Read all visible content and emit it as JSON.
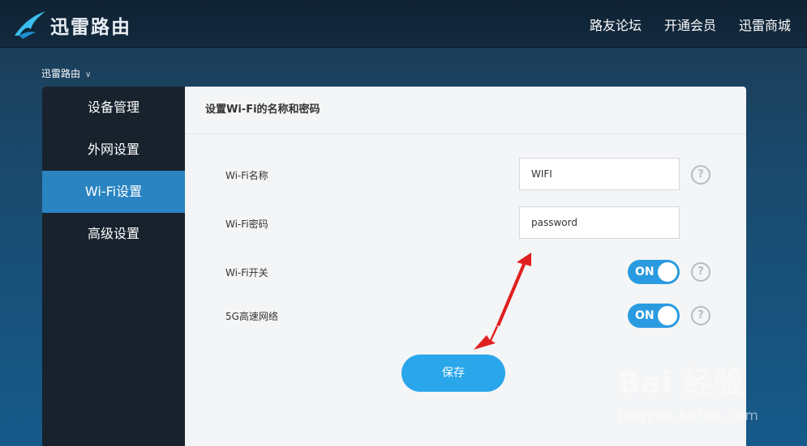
{
  "header": {
    "brand": "迅雷路由",
    "nav": [
      "路友论坛",
      "开通会员",
      "迅雷商城"
    ],
    "logo_icon": "xunlei-bird-icon"
  },
  "router_selector": {
    "label": "迅雷路由"
  },
  "sidebar": {
    "items": [
      {
        "label": "设备管理",
        "active": false
      },
      {
        "label": "外网设置",
        "active": false
      },
      {
        "label": "Wi-Fi设置",
        "active": true
      },
      {
        "label": "高级设置",
        "active": false
      }
    ]
  },
  "content": {
    "title": "设置Wi-Fi的名称和密码",
    "fields": {
      "wifi_name": {
        "label": "Wi-Fi名称",
        "value": "WIFI"
      },
      "wifi_password": {
        "label": "Wi-Fi密码",
        "value": "password"
      }
    },
    "toggles": {
      "wifi_switch": {
        "label": "Wi-Fi开关",
        "state": "ON"
      },
      "fiveg": {
        "label": "5G高速网络",
        "state": "ON"
      }
    },
    "help_glyph": "?",
    "save_label": "保存"
  },
  "watermark": {
    "main": "Bai 经验",
    "sub": "jingyan.baidu.com"
  },
  "colors": {
    "accent": "#2a84c2",
    "button": "#2aa6ea",
    "toggle": "#2a9be0",
    "annotation_arrow": "#e02020"
  }
}
